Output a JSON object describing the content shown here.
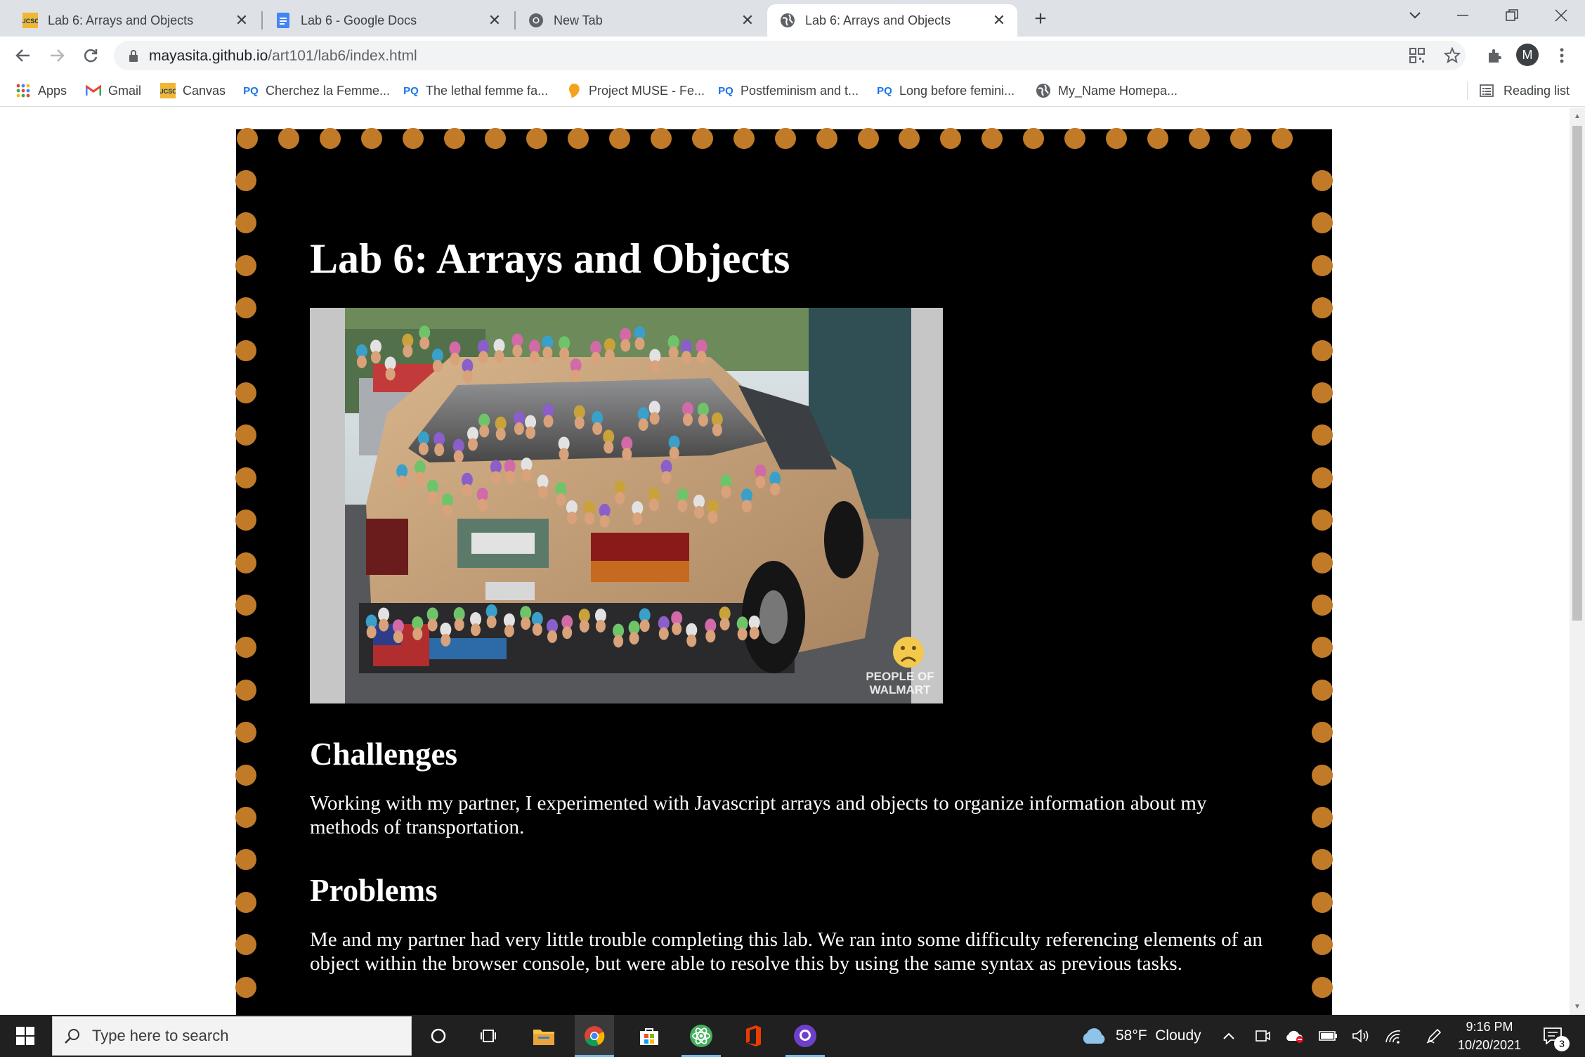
{
  "browser": {
    "tabs": [
      {
        "title": "Lab 6: Arrays and Objects",
        "icon": "ucsc-icon",
        "active": false
      },
      {
        "title": "Lab 6 - Google Docs",
        "icon": "docs-icon",
        "active": false
      },
      {
        "title": "New Tab",
        "icon": "chrome-icon",
        "active": false
      },
      {
        "title": "Lab 6: Arrays and Objects",
        "icon": "globe-icon",
        "active": true
      }
    ],
    "address": {
      "domain": "mayasita.github.io",
      "path": "/art101/lab6/index.html"
    },
    "profile_initial": "M",
    "bookmarks": [
      {
        "label": "Apps",
        "icon": "apps-grid-icon"
      },
      {
        "label": "Gmail",
        "icon": "gmail-icon"
      },
      {
        "label": "Canvas",
        "icon": "ucsc-icon"
      },
      {
        "label": "Cherchez la Femme...",
        "icon": "pq-icon"
      },
      {
        "label": "The lethal femme fa...",
        "icon": "pq-icon"
      },
      {
        "label": "Project MUSE - Fe...",
        "icon": "muse-icon"
      },
      {
        "label": "Postfeminism and t...",
        "icon": "pq-icon"
      },
      {
        "label": "Long before femini...",
        "icon": "pq-icon"
      },
      {
        "label": "My_Name Homepa...",
        "icon": "globe-icon"
      }
    ],
    "pq_text": "PQ",
    "reading_list": "Reading list"
  },
  "page": {
    "title": "Lab 6: Arrays and Objects",
    "image_watermark": [
      "PEOPLE OF",
      "WALMART"
    ],
    "sections": [
      {
        "heading": "Challenges",
        "body": "Working with my partner, I experimented with Javascript arrays and objects to organize information about my methods of transportation."
      },
      {
        "heading": "Problems",
        "body": "Me and my partner had very little trouble completing this lab. We ran into some difficulty referencing elements of an object within the browser console, but were able to resolve this by using the same syntax as previous tasks."
      }
    ],
    "colors": {
      "background": "#000000",
      "dots": "#c17a27",
      "text": "#ffffff"
    }
  },
  "taskbar": {
    "search_placeholder": "Type here to search",
    "weather": "58°F  Cloudy",
    "time": "9:16 PM",
    "date": "10/20/2021",
    "notification_count": "3"
  }
}
